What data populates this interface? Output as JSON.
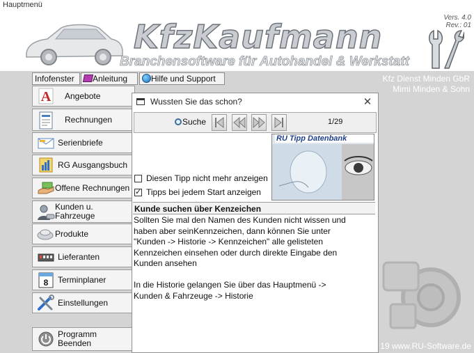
{
  "window": {
    "title": "Hauptmenü"
  },
  "header": {
    "logo": "KfzKaufmann",
    "slogan": "Branchensoftware für Autohandel & Werkstatt",
    "version": "Vers. 4.0",
    "revision": "Rev.: 01"
  },
  "toolbar": [
    {
      "label": "Infofenster",
      "icon": ""
    },
    {
      "label": "Anleitung",
      "icon": "book-icon"
    },
    {
      "label": "Hilfe und Support",
      "icon": "globe-icon"
    }
  ],
  "company": {
    "line1": "Kfz Dienst Minden GbR",
    "line2": "Mimi Minden & Sohn"
  },
  "nav": [
    {
      "label": "Angebote",
      "icon": "letter-a-icon"
    },
    {
      "label": "Rechnungen",
      "icon": "invoice-icon"
    },
    {
      "label": "Serienbriefe",
      "icon": "envelope-icon"
    },
    {
      "label": "RG Ausgangsbuch",
      "icon": "ledger-icon"
    },
    {
      "label": "Offene Rechnungen",
      "icon": "payment-icon"
    },
    {
      "label": "Kunden u.\nFahrzeuge",
      "icon": "customer-icon"
    },
    {
      "label": "Produkte",
      "icon": "products-icon"
    },
    {
      "label": "Lieferanten",
      "icon": "truck-icon"
    },
    {
      "label": "Terminplaner",
      "icon": "calendar-icon"
    },
    {
      "label": "Einstellungen",
      "icon": "tools-icon"
    },
    {
      "label": "Programm\nBeenden",
      "icon": "power-icon"
    }
  ],
  "footer": {
    "copyright": "19 www.RU-Software.de"
  },
  "dialog": {
    "title": "Wussten Sie das schon?",
    "search_label": "Suche",
    "page": "1/29",
    "image_caption": "RU Tipp Datenbank",
    "checkbox_hide": {
      "label": "Diesen Tipp nicht mehr anzeigen",
      "checked": false
    },
    "checkbox_start": {
      "label": "Tipps bei jedem Start anzeigen",
      "checked": true
    },
    "tip_title": "Kunde suchen über Kenzeichen",
    "tip_text": "Sollten Sie mal den Namen des Kunden nicht wissen und\nhaben aber seinKennzeichen, dann können Sie unter\n\"Kunden -> Historie -> Kennzeichen\" alle gelisteten\nKennzeichen einsehen oder durch direkte Eingabe den\nKunden ansehen\n\nIn die Historie gelangen Sie über das Hauptmenü ->\nKunden & Fahrzeuge -> Historie"
  },
  "colors": {
    "main_bg": "#d4d4d4",
    "company_text": "#ffffff",
    "accent_red": "#c62828"
  }
}
